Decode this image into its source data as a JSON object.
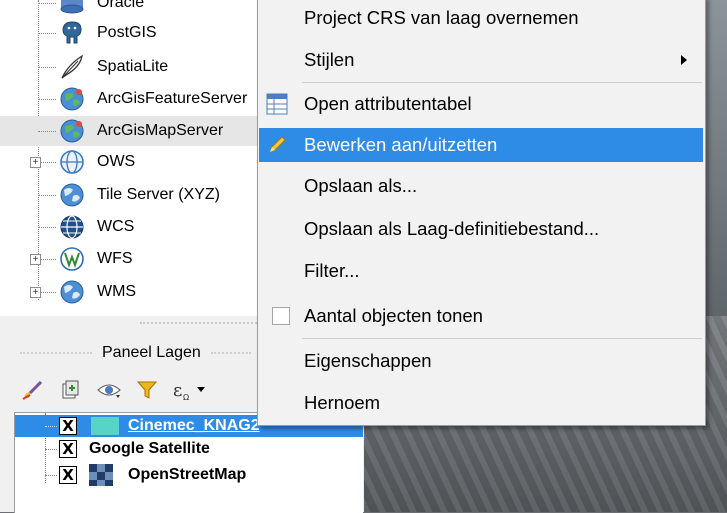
{
  "browser": {
    "items": [
      {
        "label": "Oracle",
        "icon": "oracle-db-icon"
      },
      {
        "label": "PostGIS",
        "icon": "postgis-elephant-icon"
      },
      {
        "label": "SpatiaLite",
        "icon": "spatialite-feather-icon"
      },
      {
        "label": "ArcGisFeatureServer",
        "icon": "arcgis-feature-server-icon"
      },
      {
        "label": "ArcGisMapServer",
        "icon": "arcgis-map-server-icon"
      },
      {
        "label": "OWS",
        "icon": "ows-globe-icon"
      },
      {
        "label": "Tile Server (XYZ)",
        "icon": "xyz-tile-globe-icon"
      },
      {
        "label": "WCS",
        "icon": "wcs-globe-icon"
      },
      {
        "label": "WFS",
        "icon": "wfs-globe-icon"
      },
      {
        "label": "WMS",
        "icon": "wms-globe-icon"
      }
    ],
    "selected_item": "ArcGisMapServer"
  },
  "panel": {
    "title": "Paneel Lagen",
    "toolbar_icons": [
      "style-brush-icon",
      "add-group-icon",
      "eye-visibility-icon",
      "filter-funnel-icon",
      "expression-filter-icon"
    ],
    "layers": [
      {
        "label": "Cinemec_KNAG2",
        "checked": "X",
        "selected": true
      },
      {
        "label": "Google Satellite",
        "checked": "X",
        "selected": false
      },
      {
        "label": "OpenStreetMap",
        "checked": "X",
        "selected": false
      }
    ]
  },
  "context_menu": {
    "items": [
      {
        "label": "Project CRS van laag overnemen"
      },
      {
        "label": "Stijlen",
        "submenu": true
      },
      {
        "label": "Open attributentabel",
        "icon": "attribute-table-icon"
      },
      {
        "label": "Bewerken aan/uitzetten",
        "icon": "edit-pencil-icon",
        "highlighted": true
      },
      {
        "label": "Opslaan als..."
      },
      {
        "label": "Opslaan als Laag-definitiebestand..."
      },
      {
        "label": "Filter..."
      },
      {
        "label": "Aantal objecten tonen",
        "checkbox": true,
        "checked": false
      },
      {
        "label": "Eigenschappen"
      },
      {
        "label": "Hernoem"
      }
    ]
  },
  "colors": {
    "highlight": "#2f8ce6",
    "menu_bg": "#f2f2f2",
    "selected_row_bg": "#e6e6e6"
  }
}
